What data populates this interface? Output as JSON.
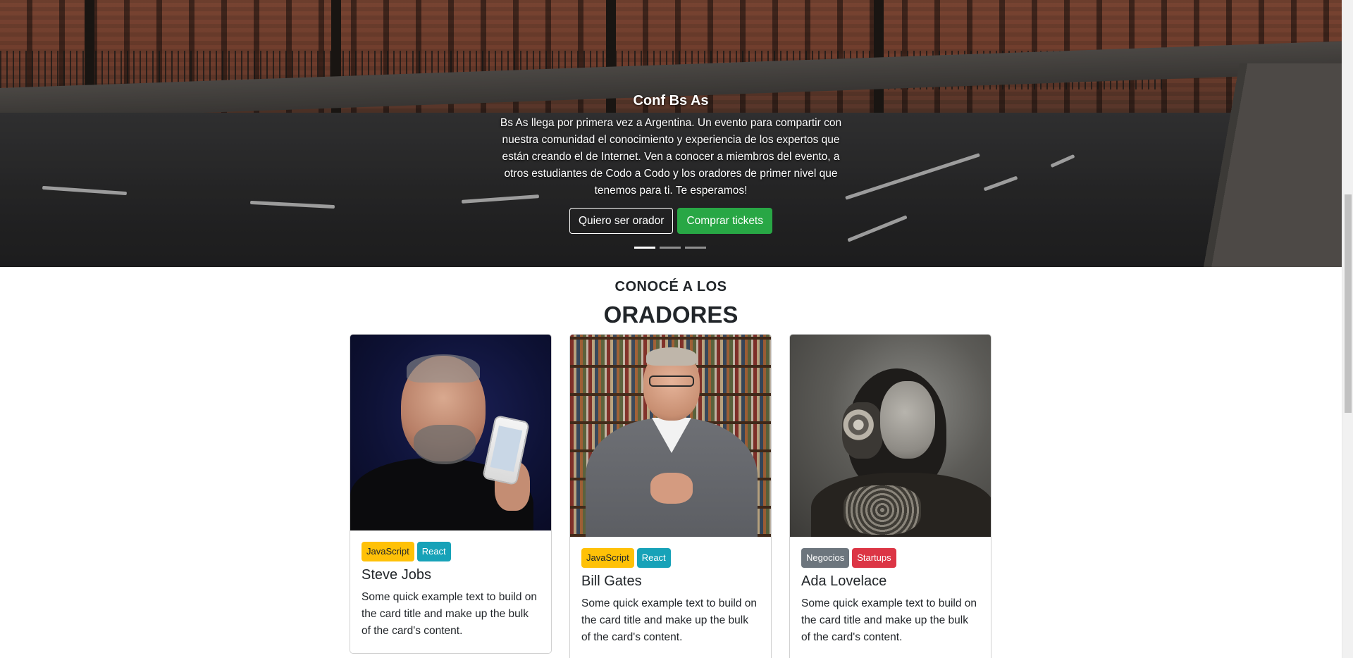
{
  "hero": {
    "title": "Conf Bs As",
    "description": "Bs As llega por primera vez a Argentina. Un evento para compartir con nuestra comunidad el conocimiento y experiencia de los expertos que están creando el de Internet. Ven a conocer a miembros del evento, a otros estudiantes de Codo a Codo y los oradores de primer nivel que tenemos para ti. Te esperamos!",
    "btn_orador": "Quiero ser orador",
    "btn_tickets": "Comprar tickets",
    "slides": 3,
    "active_slide": 1
  },
  "speakers": {
    "subtitle": "CONOCÉ A LOS",
    "title": "ORADORES",
    "cards": [
      {
        "name": "Steve Jobs",
        "tags": [
          "JavaScript",
          "React"
        ],
        "text": "Some quick example text to build on the card title and make up the bulk of the card's content."
      },
      {
        "name": "Bill Gates",
        "tags": [
          "JavaScript",
          "React"
        ],
        "text": "Some quick example text to build on the card title and make up the bulk of the card's content."
      },
      {
        "name": "Ada Lovelace",
        "tags": [
          "Negocios",
          "Startups"
        ],
        "text": "Some quick example text to build on the card title and make up the bulk of the card's content."
      }
    ]
  },
  "colors": {
    "success": "#28a745",
    "warning": "#ffc107",
    "info": "#17a2b8",
    "secondary": "#6c757d",
    "danger": "#dc3545"
  }
}
